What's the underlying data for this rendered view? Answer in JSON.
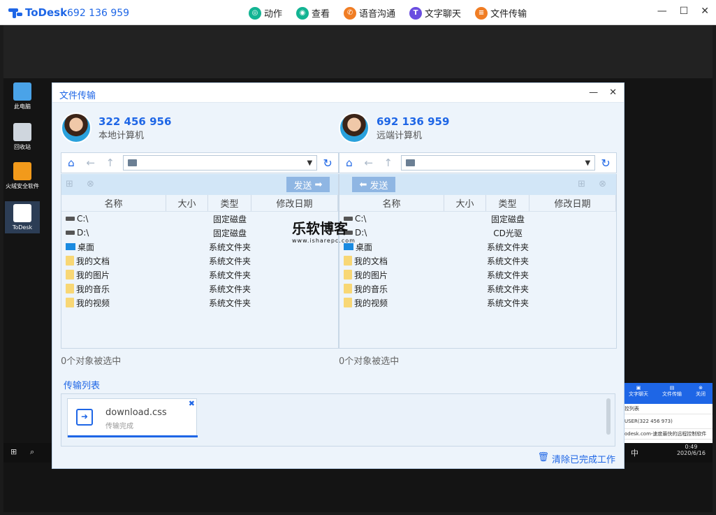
{
  "app": {
    "name": "ToDesk",
    "id": "692 136 959"
  },
  "actions": [
    {
      "label": "动作",
      "color": "#13b493",
      "glyph": "◎"
    },
    {
      "label": "查看",
      "color": "#13b493",
      "glyph": "◉"
    },
    {
      "label": "语音沟通",
      "color": "#f07d24",
      "glyph": "✆"
    },
    {
      "label": "文字聊天",
      "color": "#6a4de0",
      "glyph": "T"
    },
    {
      "label": "文件传输",
      "color": "#f07d24",
      "glyph": "≡"
    }
  ],
  "window_controls": {
    "minimize": "—",
    "maximize": "☐",
    "close": "✕"
  },
  "desktop_icons": [
    "此电脑",
    "回收站",
    "火绒安全软件",
    "ToDesk"
  ],
  "taskbar": {
    "time": "0:49",
    "date": "2020/6/16",
    "ime": "中"
  },
  "side_panel": {
    "buttons": [
      "文字聊天",
      "文件传输",
      "关闭"
    ],
    "rows": [
      "控列表",
      "USER(322 456 973)",
      "odesk.com-速度最快的远程控制软件"
    ]
  },
  "dialog": {
    "title": "文件传输",
    "send_label": "发送",
    "columns": [
      "名称",
      "大小",
      "类型",
      "修改日期"
    ],
    "local": {
      "id": "322 456 956",
      "label": "本地计算机",
      "status": "0个对象被选中",
      "files": [
        {
          "name": "C:\\",
          "type": "固定磁盘",
          "icon": "drive"
        },
        {
          "name": "D:\\",
          "type": "固定磁盘",
          "icon": "drive"
        },
        {
          "name": "桌面",
          "type": "系统文件夹",
          "icon": "desktop"
        },
        {
          "name": "我的文档",
          "type": "系统文件夹",
          "icon": "folder"
        },
        {
          "name": "我的图片",
          "type": "系统文件夹",
          "icon": "folder"
        },
        {
          "name": "我的音乐",
          "type": "系统文件夹",
          "icon": "folder"
        },
        {
          "name": "我的视频",
          "type": "系统文件夹",
          "icon": "folder"
        }
      ]
    },
    "remote": {
      "id": "692 136 959",
      "label": "远端计算机",
      "status": "0个对象被选中",
      "files": [
        {
          "name": "C:\\",
          "type": "固定磁盘",
          "icon": "drive"
        },
        {
          "name": "D:\\",
          "type": "CD光驱",
          "icon": "drive"
        },
        {
          "name": "桌面",
          "type": "系统文件夹",
          "icon": "desktop"
        },
        {
          "name": "我的文档",
          "type": "系统文件夹",
          "icon": "folder"
        },
        {
          "name": "我的图片",
          "type": "系统文件夹",
          "icon": "folder"
        },
        {
          "name": "我的音乐",
          "type": "系统文件夹",
          "icon": "folder"
        },
        {
          "name": "我的视频",
          "type": "系统文件夹",
          "icon": "folder"
        }
      ]
    },
    "transfer": {
      "tab": "传输列表",
      "file": "download.css",
      "status": "传输完成",
      "progress": 1.0,
      "clear_label": "清除已完成工作"
    }
  },
  "watermark": {
    "main": "乐软博客",
    "sub": "www.isharepc.com"
  }
}
